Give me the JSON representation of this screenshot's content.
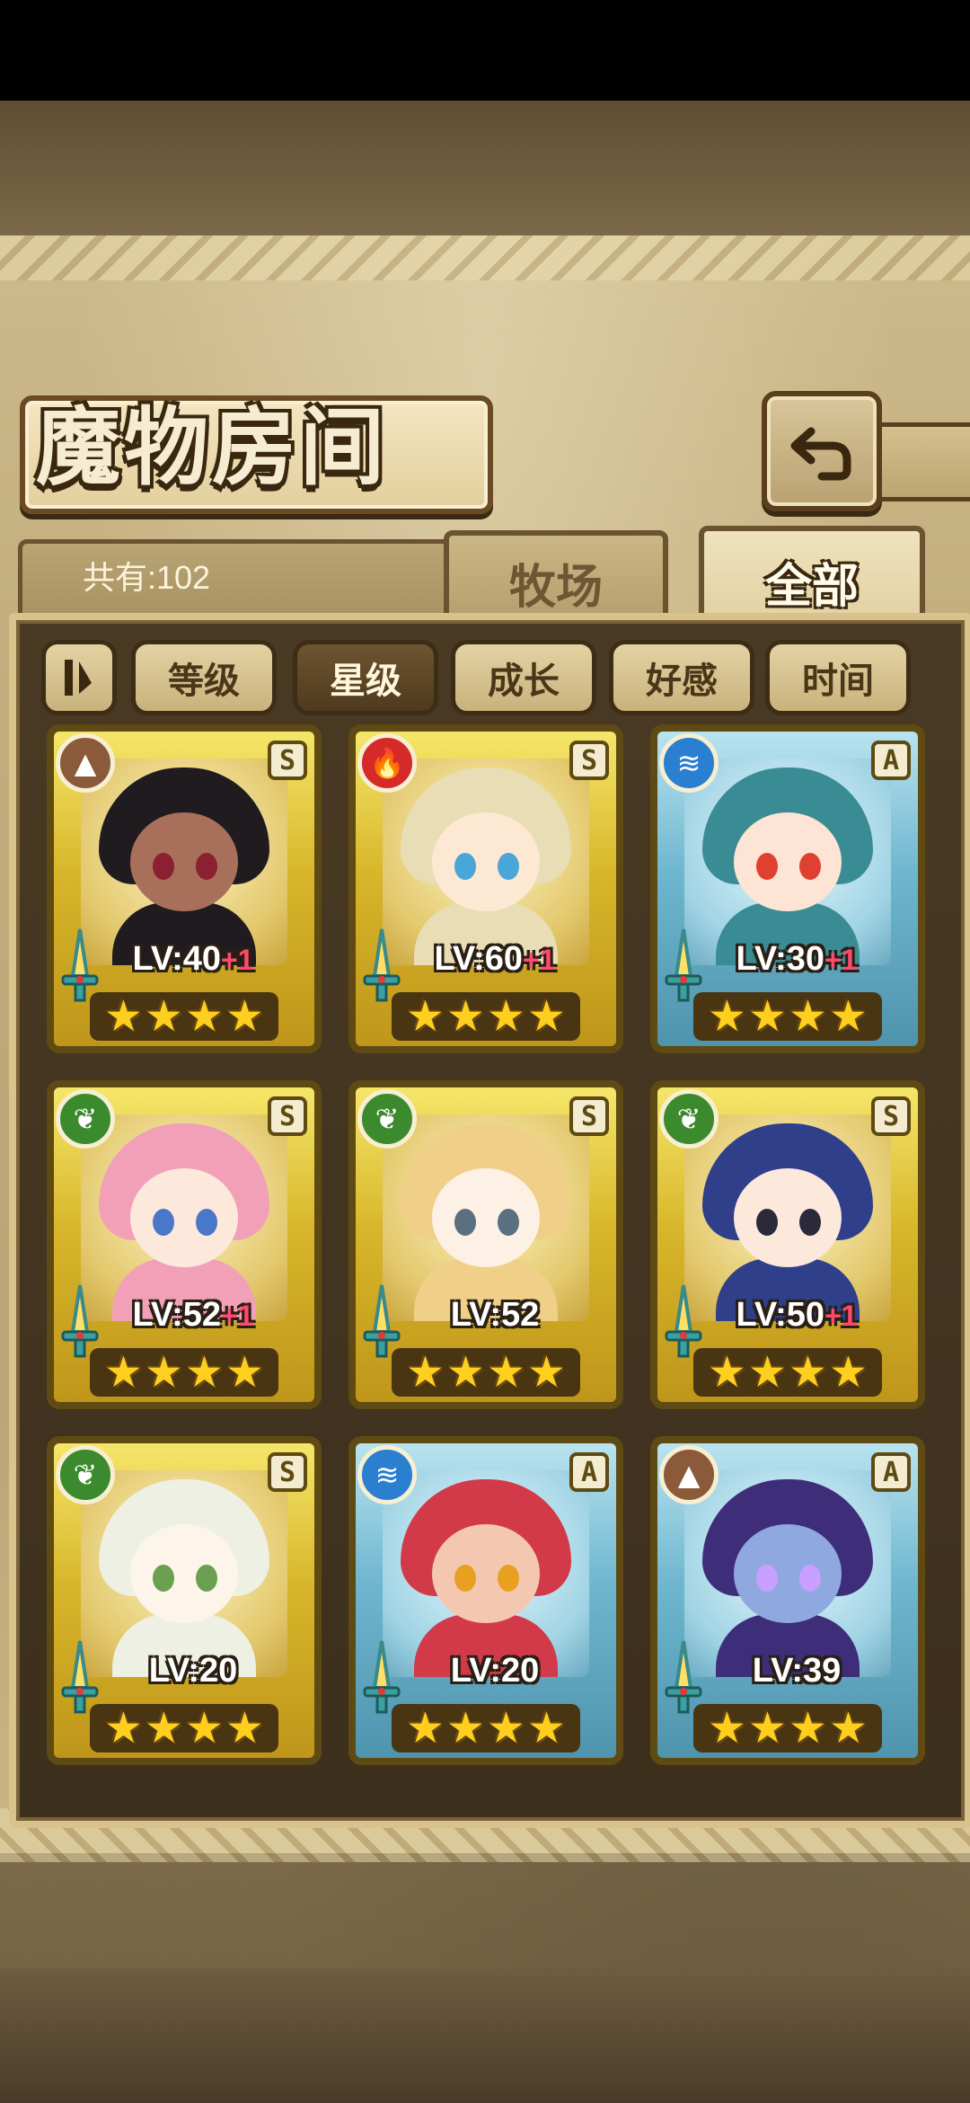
{
  "title": "魔物房间",
  "count_text": "共有:102",
  "tabs": [
    {
      "label": "牧场",
      "active": false
    },
    {
      "label": "全部",
      "active": true
    }
  ],
  "sort_buttons": [
    "等级",
    "星级",
    "成长",
    "好感",
    "时间"
  ],
  "active_sort": "星级",
  "icons": {
    "filter": "filter-toggle-icon",
    "back": "back-arrow-icon"
  },
  "cards": [
    {
      "frame": "gold",
      "element": "earth",
      "rank": "S",
      "lv": "LV:40",
      "bonus": "+1",
      "stars": 4,
      "hair": "#1f1b1f",
      "skin": "#a8705a",
      "eyes": "#8a2030"
    },
    {
      "frame": "gold",
      "element": "fire",
      "rank": "S",
      "lv": "LV:60",
      "bonus": "+1",
      "stars": 4,
      "hair": "#e9ddb6",
      "skin": "#fde8d4",
      "eyes": "#4aa5d8"
    },
    {
      "frame": "blue",
      "element": "water",
      "rank": "A",
      "lv": "LV:30",
      "bonus": "+1",
      "stars": 4,
      "hair": "#3a8c94",
      "skin": "#fde4d4",
      "eyes": "#e04030"
    },
    {
      "frame": "gold",
      "element": "nature",
      "rank": "S",
      "lv": "LV:52",
      "bonus": "+1",
      "stars": 4,
      "hair": "#f2a0b8",
      "skin": "#fde8dc",
      "eyes": "#4a78c8"
    },
    {
      "frame": "gold",
      "element": "nature",
      "rank": "S",
      "lv": "LV:52",
      "bonus": "",
      "stars": 4,
      "hair": "#f0cf88",
      "skin": "#fdf0e4",
      "eyes": "#5a6f80"
    },
    {
      "frame": "gold",
      "element": "nature",
      "rank": "S",
      "lv": "LV:50",
      "bonus": "+1",
      "stars": 4,
      "hair": "#2f3f8a",
      "skin": "#fde8dc",
      "eyes": "#2a2a3a"
    },
    {
      "frame": "gold",
      "element": "nature",
      "rank": "S",
      "lv": "LV:20",
      "bonus": "",
      "stars": 4,
      "hair": "#eef0e4",
      "skin": "#fdf4ea",
      "eyes": "#6aa050"
    },
    {
      "frame": "blue",
      "element": "water",
      "rank": "A",
      "lv": "LV:20",
      "bonus": "",
      "stars": 4,
      "hair": "#d23a4a",
      "skin": "#f4c8b0",
      "eyes": "#e8a020"
    },
    {
      "frame": "blue",
      "element": "earth",
      "rank": "A",
      "lv": "LV:39",
      "bonus": "",
      "stars": 4,
      "hair": "#3e2e7a",
      "skin": "#8fa8e0",
      "eyes": "#c8a0ff"
    }
  ]
}
